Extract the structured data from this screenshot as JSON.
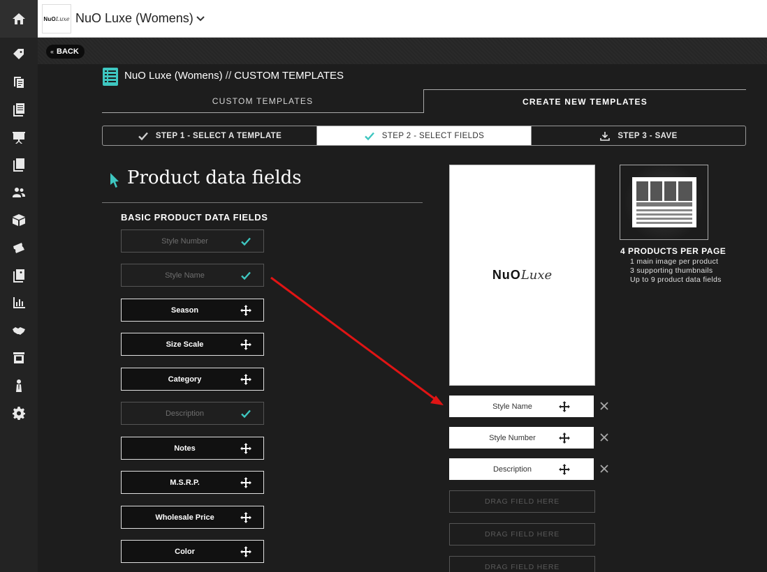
{
  "app": {
    "title": "NuO Luxe (Womens)",
    "logo_text_bold": "NuO",
    "logo_text_script": "Luxe"
  },
  "nav": {
    "back_label": "BACK"
  },
  "page": {
    "breadcrumb_brand": "NuO Luxe (Womens)",
    "breadcrumb_sep": "//",
    "breadcrumb_section": "CUSTOM TEMPLATES"
  },
  "tabs": {
    "custom": "CUSTOM TEMPLATES",
    "create": "CREATE NEW TEMPLATES",
    "active": "create"
  },
  "steps": [
    {
      "label": "STEP 1 - SELECT A TEMPLATE",
      "icon": "check-icon",
      "state": "done"
    },
    {
      "label": "STEP 2 - SELECT FIELDS",
      "icon": "check-icon",
      "state": "active"
    },
    {
      "label": "STEP 3 - SAVE",
      "icon": "download-icon",
      "state": "pending"
    }
  ],
  "fields_section": {
    "title": "Product data fields",
    "basic_label": "BASIC PRODUCT DATA FIELDS",
    "fields": [
      {
        "label": "Style Number",
        "state": "used"
      },
      {
        "label": "Style Name",
        "state": "used"
      },
      {
        "label": "Season",
        "state": "available"
      },
      {
        "label": "Size Scale",
        "state": "available"
      },
      {
        "label": "Category",
        "state": "available"
      },
      {
        "label": "Description",
        "state": "used"
      },
      {
        "label": "Notes",
        "state": "available"
      },
      {
        "label": "M.S.R.P.",
        "state": "available"
      },
      {
        "label": "Wholesale Price",
        "state": "available"
      },
      {
        "label": "Color",
        "state": "available"
      }
    ]
  },
  "preview": {
    "brand_bold": "NuO",
    "brand_script": "Luxe",
    "slots": [
      "Style Name",
      "Style Number",
      "Description"
    ],
    "drop_label": "DRAG FIELD HERE"
  },
  "template_info": {
    "title": "4 PRODUCTS PER PAGE",
    "lines": [
      "1 main image per product",
      "3 supporting thumbnails",
      "Up to 9 product data fields"
    ]
  },
  "colors": {
    "accent_teal": "#3ec6c0",
    "annotation_red": "#e01414"
  }
}
